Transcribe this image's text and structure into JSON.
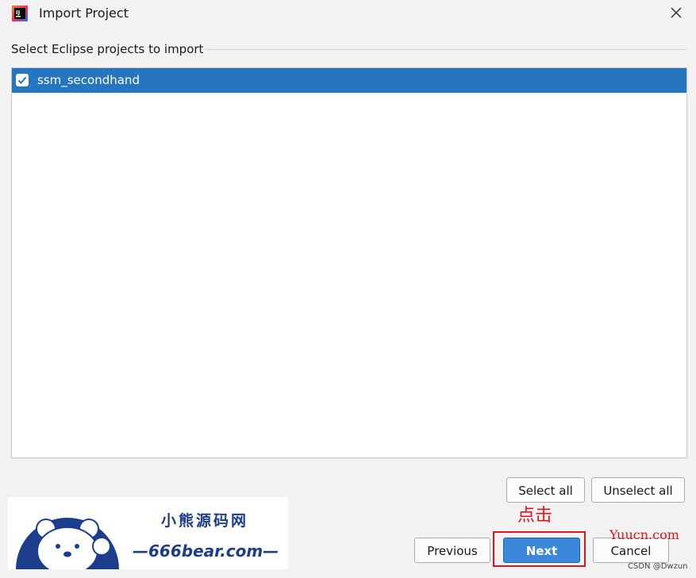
{
  "window": {
    "title": "Import Project",
    "app_icon": "intellij-icon",
    "close_icon": "close-icon"
  },
  "section": {
    "label": "Select Eclipse projects to import"
  },
  "projects": [
    {
      "label": "ssm_secondhand",
      "checked": true
    }
  ],
  "buttons": {
    "select_all": "Select all",
    "unselect_all": "Unselect all",
    "previous": "Previous",
    "next": "Next",
    "cancel": "Cancel"
  },
  "annotation": {
    "text": "点击",
    "color": "#e0141e"
  },
  "watermarks": {
    "logo_title": "小熊源码网",
    "logo_url": "—666bear.com—",
    "site": "Yuucn.com",
    "csdn": "CSDN @Dwzun"
  },
  "colors": {
    "accent": "#2675bf",
    "next_button": "#3b87d9",
    "highlight": "#e0141e"
  }
}
